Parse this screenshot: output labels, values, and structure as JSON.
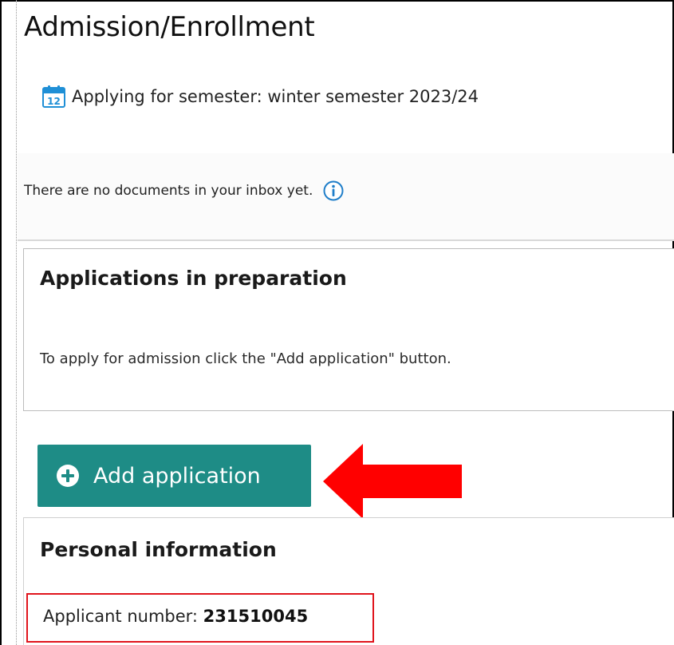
{
  "page": {
    "title": "Admission/Enrollment"
  },
  "semester": {
    "icon": "calendar-icon",
    "icon_day": "12",
    "text": "Applying for semester: winter semester 2023/24"
  },
  "inbox": {
    "message": "There are no documents in your inbox yet.",
    "icon": "info-icon"
  },
  "applications": {
    "heading": "Applications in preparation",
    "instruction": "To apply for admission click the \"Add application\" button.",
    "add_button_label": "Add application",
    "add_button_icon": "plus-circle-icon"
  },
  "personal": {
    "heading": "Personal information",
    "applicant_label": "Applicant number: ",
    "applicant_number": "231510045"
  },
  "colors": {
    "button_bg": "#1e8c86",
    "arrow": "#ff0000",
    "highlight_border": "#e0141c",
    "calendar_blue": "#1f8fd6"
  }
}
